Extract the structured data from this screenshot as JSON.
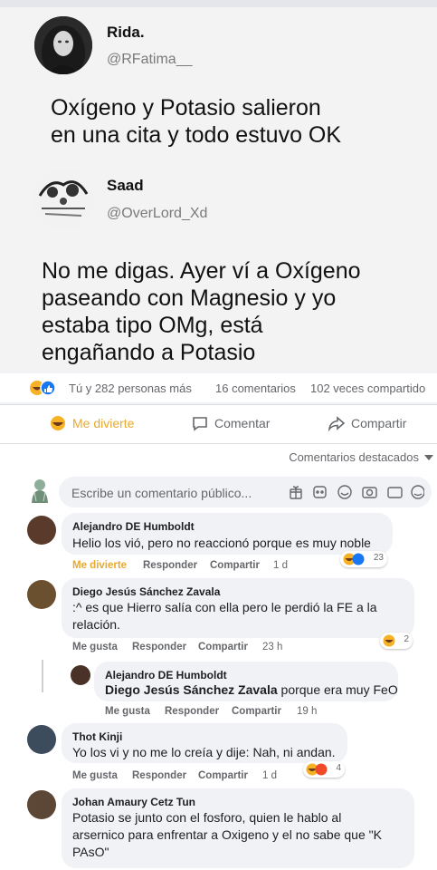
{
  "tweet1": {
    "name": "Rida.",
    "handle": "@RFatima__",
    "lines": [
      "Oxígeno y Potasio salieron",
      "en una cita y todo estuvo OK"
    ]
  },
  "tweet2": {
    "name": "Saad",
    "handle": "@OverLord_Xd",
    "lines": [
      "No me digas. Ayer ví a Oxígeno",
      "paseando con Magnesio y yo",
      "estaba tipo OMg, está",
      "engañando a Potasio"
    ]
  },
  "stats": {
    "reactions": "Tú y 282 personas más",
    "comments": "16 comentarios",
    "shares": "102 veces compartido"
  },
  "actions": {
    "laugh": "Me divierte",
    "comment": "Comentar",
    "share": "Compartir"
  },
  "sort": {
    "label": "Comentarios destacados"
  },
  "composer": {
    "placeholder": "Escribe un comentario público..."
  },
  "comments": [
    {
      "author": "Alejandro DE Humboldt",
      "lines": [
        "Helio los vió, pero no reaccionó porque es muy noble"
      ],
      "reaction": "Me divierte",
      "reply": "Responder",
      "share": "Compartir",
      "time": "1 d",
      "count": "23"
    },
    {
      "author": "Diego Jesús Sánchez Zavala",
      "lines": [
        ":^ es que Hierro salía con ella pero le perdió la FE a la",
        "relación."
      ],
      "reaction": "Me gusta",
      "reply": "Responder",
      "share": "Compartir",
      "time": "23 h",
      "count": "2"
    },
    {
      "author": "Alejandro DE Humboldt",
      "mention": "Diego Jesús Sánchez Zavala",
      "text": " porque era muy FeO",
      "reaction": "Me gusta",
      "reply": "Responder",
      "share": "Compartir",
      "time": "19 h"
    },
    {
      "author": "Thot Kinji",
      "lines": [
        "Yo los vi y no me lo creía y dije: Nah, ni andan."
      ],
      "reaction": "Me gusta",
      "reply": "Responder",
      "share": "Compartir",
      "time": "1 d",
      "count": "4"
    },
    {
      "author": "Johan Amaury Cetz Tun",
      "lines": [
        "Potasio se junto con el fosforo, quien le hablo al",
        "arsernico para enfrentar a Oxigeno y el no sabe que \"K",
        "PAsO\""
      ]
    }
  ],
  "colors": {
    "laugh": "#e8a930",
    "like": "#1877f2",
    "meta": "#65676b",
    "bubble": "#f0f2f5"
  },
  "icons": [
    "laugh-emoji-icon",
    "like-icon",
    "comment-icon",
    "share-icon",
    "caret-down-icon",
    "sticker-icon",
    "emoji-icon",
    "camera-icon",
    "gif-icon",
    "avatar-sticker-icon"
  ]
}
